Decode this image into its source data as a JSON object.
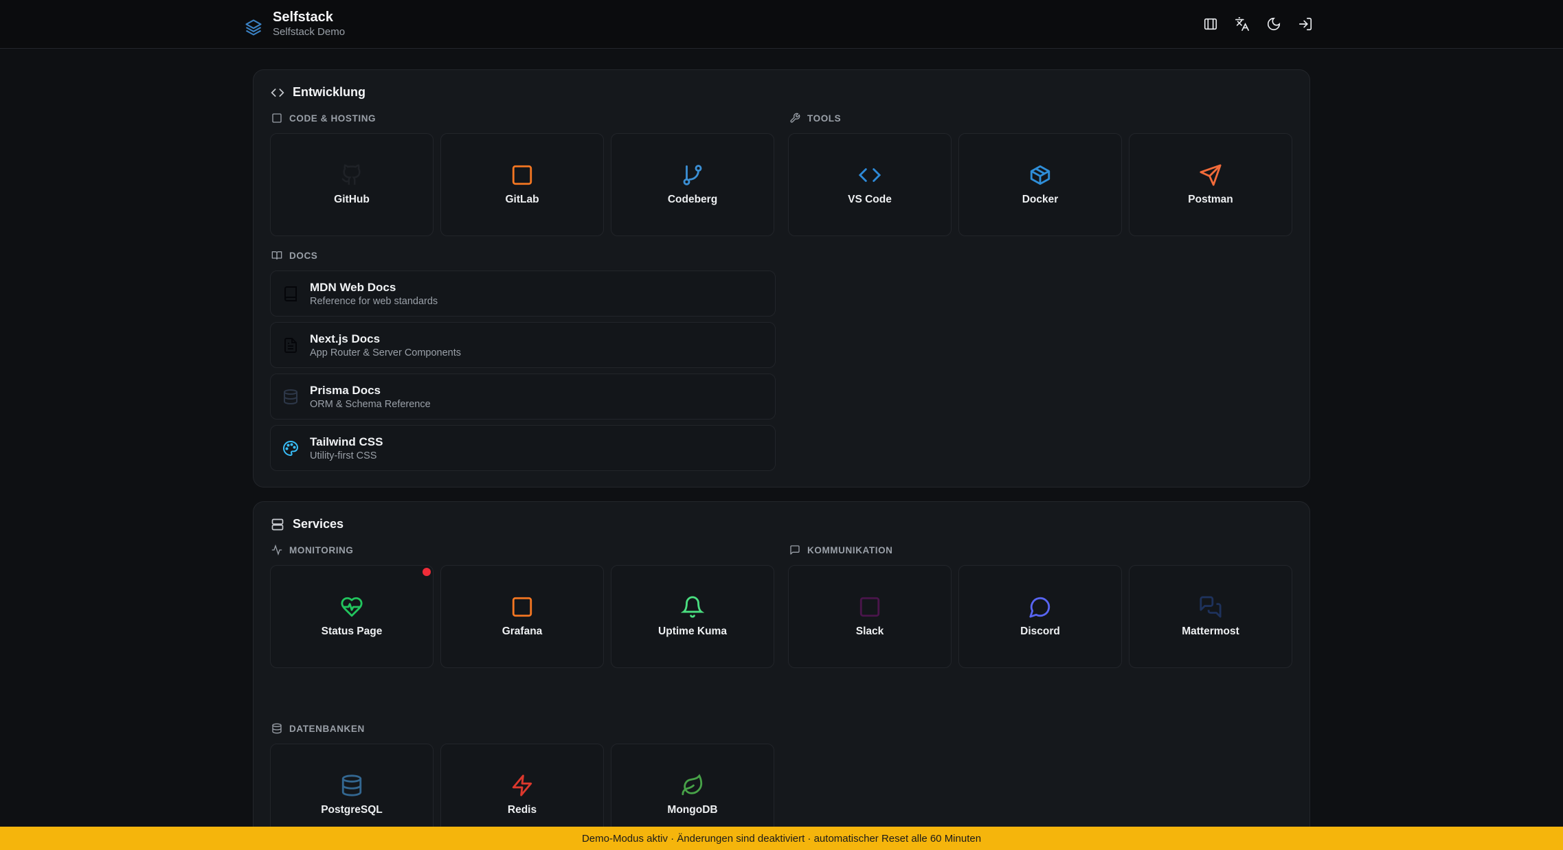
{
  "header": {
    "title": "Selfstack",
    "subtitle": "Selfstack Demo",
    "logo_icon": "layers-icon",
    "actions": [
      {
        "name": "layout-toggle",
        "icon": "columns-icon"
      },
      {
        "name": "language",
        "icon": "translate-icon"
      },
      {
        "name": "theme",
        "icon": "moon-icon"
      },
      {
        "name": "login",
        "icon": "login-icon"
      }
    ]
  },
  "sections": [
    {
      "title": "Entwicklung",
      "icon": "code-icon",
      "groups": {
        "code_hosting": {
          "label": "CODE & HOSTING",
          "icon": "square-icon",
          "tiles": [
            {
              "label": "GitHub",
              "icon": "github-icon",
              "color": "#1f2227"
            },
            {
              "label": "GitLab",
              "icon": "square-icon",
              "color": "#f57722"
            },
            {
              "label": "Codeberg",
              "icon": "git-branch-icon",
              "color": "#3b8fd4"
            }
          ]
        },
        "tools": {
          "label": "TOOLS",
          "icon": "wrench-icon",
          "tiles": [
            {
              "label": "VS Code",
              "icon": "code-icon",
              "color": "#2e8ad8"
            },
            {
              "label": "Docker",
              "icon": "box-icon",
              "color": "#2f8ed8"
            },
            {
              "label": "Postman",
              "icon": "send-icon",
              "color": "#f26b3a"
            }
          ]
        },
        "docs": {
          "label": "DOCS",
          "icon": "book-open-icon",
          "items": [
            {
              "title": "MDN Web Docs",
              "description": "Reference for web standards",
              "icon": "book-icon",
              "color": "#0a0b0d"
            },
            {
              "title": "Next.js Docs",
              "description": "App Router & Server Components",
              "icon": "file-text-icon",
              "color": "#0a0b0d"
            },
            {
              "title": "Prisma Docs",
              "description": "ORM & Schema Reference",
              "icon": "database-icon",
              "color": "#2d3748"
            },
            {
              "title": "Tailwind CSS",
              "description": "Utility-first CSS",
              "icon": "palette-icon",
              "color": "#38bdf8"
            }
          ]
        }
      }
    },
    {
      "title": "Services",
      "icon": "server-icon",
      "groups": {
        "monitoring": {
          "label": "MONITORING",
          "icon": "activity-icon",
          "tiles": [
            {
              "label": "Status Page",
              "icon": "heart-pulse-icon",
              "color": "#22c55e",
              "status": "down"
            },
            {
              "label": "Grafana",
              "icon": "square-icon",
              "color": "#f57722"
            },
            {
              "label": "Uptime Kuma",
              "icon": "bell-icon",
              "color": "#4ade80"
            }
          ]
        },
        "communication": {
          "label": "KOMMUNIKATION",
          "icon": "message-square-icon",
          "tiles": [
            {
              "label": "Slack",
              "icon": "square-icon",
              "color": "#4a154b"
            },
            {
              "label": "Discord",
              "icon": "message-circle-icon",
              "color": "#5865f2"
            },
            {
              "label": "Mattermost",
              "icon": "messages-icon",
              "color": "#1e325c"
            }
          ]
        },
        "databases": {
          "label": "DATENBANKEN",
          "icon": "database-icon",
          "tiles": [
            {
              "label": "PostgreSQL",
              "icon": "database-icon",
              "color": "#336791"
            },
            {
              "label": "Redis",
              "icon": "zap-icon",
              "color": "#dc382d"
            },
            {
              "label": "MongoDB",
              "icon": "leaf-icon",
              "color": "#47a248"
            }
          ]
        }
      }
    }
  ],
  "banner": {
    "text": "Demo-Modus aktiv · Änderungen sind deaktiviert · automatischer Reset alle 60 Minuten",
    "color": "#f5b50c"
  }
}
